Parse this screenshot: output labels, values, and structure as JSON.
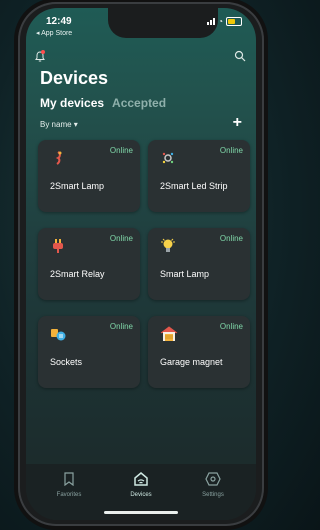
{
  "status": {
    "time": "12:49",
    "back_label": "◂ App Store"
  },
  "header": {
    "title": "Devices",
    "bell_icon": "bell-icon",
    "search_icon": "search-icon"
  },
  "tabs": [
    {
      "label": "My devices",
      "active": true
    },
    {
      "label": "Accepted",
      "active": false
    }
  ],
  "sort": {
    "label": "By name ▾",
    "add_label": "+"
  },
  "devices": [
    {
      "name": "2Smart Lamp",
      "status": "Online",
      "icon": "lamp-icon"
    },
    {
      "name": "2Smart Led Strip",
      "status": "Online",
      "icon": "led-strip-icon"
    },
    {
      "name": "2Smart Relay",
      "status": "Online",
      "icon": "plug-icon"
    },
    {
      "name": "Smart Lamp",
      "status": "Online",
      "icon": "bulb-icon"
    },
    {
      "name": "Sockets",
      "status": "Online",
      "icon": "socket-icon"
    },
    {
      "name": "Garage magnet",
      "status": "Online",
      "icon": "garage-icon"
    }
  ],
  "tabbar": [
    {
      "label": "Favorites",
      "icon": "bookmark-icon"
    },
    {
      "label": "Devices",
      "icon": "home-icon",
      "active": true
    },
    {
      "label": "Settings",
      "icon": "settings-icon"
    }
  ]
}
